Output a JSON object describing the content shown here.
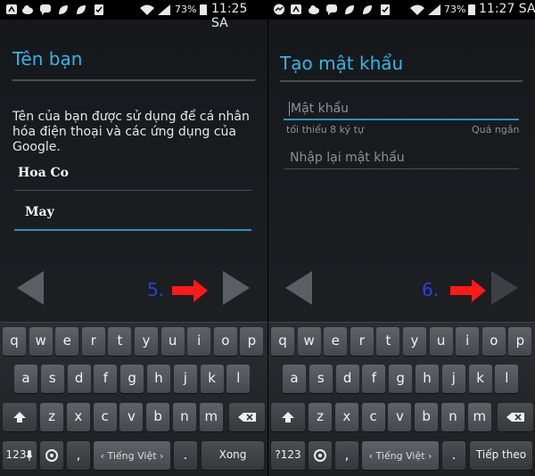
{
  "status_left": {
    "battery_pct": "73%",
    "time": "11:25 SA"
  },
  "status_right": {
    "battery_pct": "73%",
    "time": "11:27 SA"
  },
  "name_screen": {
    "title": "Tên bạn",
    "description": "Tên của bạn được sử dụng để cá nhân hóa điện thoại và các ứng dụng của Google.",
    "first_name_value": "Hoa Co",
    "last_name_value": "May",
    "step_number": "5."
  },
  "password_screen": {
    "title": "Tạo mật khẩu",
    "password_placeholder": "Mật khẩu",
    "min_hint": "tối thiểu 8 ký tự",
    "strength_hint": "Quá ngắn",
    "confirm_placeholder": "Nhập lại mật khẩu",
    "step_number": "6."
  },
  "keyboard": {
    "row1": [
      "q",
      "w",
      "e",
      "r",
      "t",
      "y",
      "u",
      "i",
      "o",
      "p"
    ],
    "row2": [
      "a",
      "s",
      "d",
      "f",
      "g",
      "h",
      "j",
      "k",
      "l"
    ],
    "row3": [
      "z",
      "x",
      "c",
      "v",
      "b",
      "n",
      "m"
    ],
    "left": {
      "symbols_label": "123",
      "space_label": "Tiếng Việt",
      "action_label": "Xong",
      "period": "."
    },
    "right": {
      "symbols_label": "?123",
      "space_label": "Tiếng Việt",
      "action_label": "Tiếp theo",
      "period": "."
    },
    "comma": ","
  },
  "colors": {
    "accent": "#35b5e5",
    "step_number": "#2b3fe0",
    "red_arrow": "#ff1a1a"
  }
}
